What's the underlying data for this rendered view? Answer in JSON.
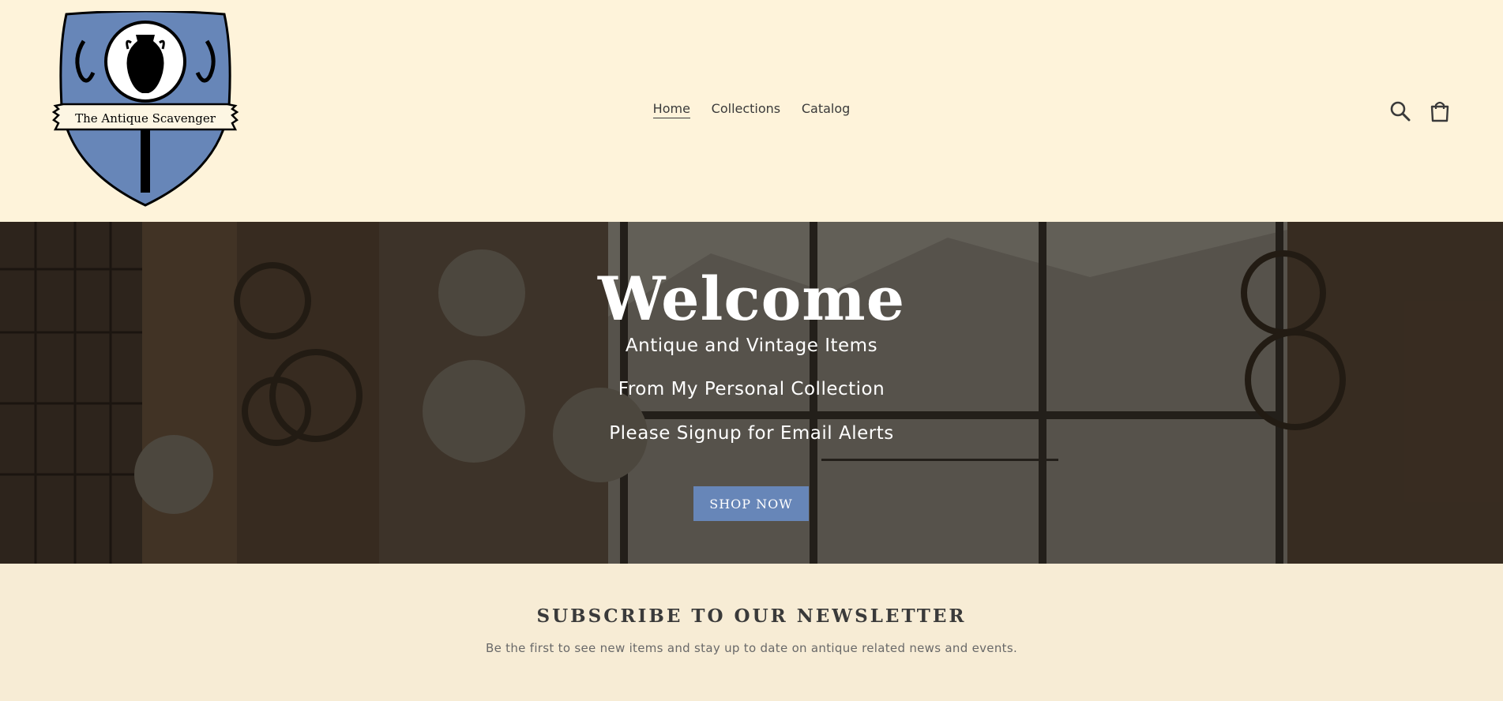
{
  "header": {
    "logo_text": "The Antique Scavenger",
    "nav": [
      {
        "label": "Home",
        "active": true
      },
      {
        "label": "Collections",
        "active": false
      },
      {
        "label": "Catalog",
        "active": false
      }
    ],
    "icons": [
      "search-icon",
      "cart-icon"
    ]
  },
  "hero": {
    "title": "Welcome",
    "line1": "Antique and Vintage Items",
    "line2": "From My Personal Collection",
    "line3": "Please Signup for Email Alerts",
    "button_label": "SHOP NOW"
  },
  "newsletter": {
    "title": "SUBSCRIBE TO OUR NEWSLETTER",
    "subtitle": "Be the first to see new items and stay up to date on antique related news and events."
  },
  "colors": {
    "header_bg": "#fef3da",
    "accent": "#6786b8",
    "newsletter_bg": "#f7ecd5",
    "text": "#3a3a3a"
  }
}
